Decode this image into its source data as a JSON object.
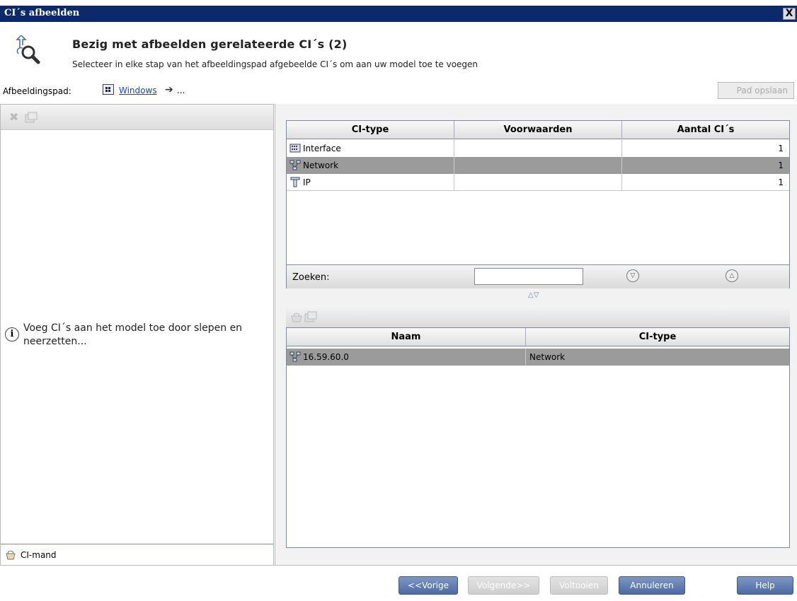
{
  "window": {
    "title": "CI´s afbeelden",
    "close_label": "X"
  },
  "header": {
    "title": "Bezig met afbeelden gerelateerde CI´s (2)",
    "subtitle": "Selecteer in elke stap van het afbeeldingspad afgebeelde CI´s om aan uw model toe te voegen"
  },
  "path": {
    "label": "Afbeeldingspad:",
    "link": "Windows",
    "arrow": "➔",
    "ellipsis": "...",
    "save_button": "Pad opslaan"
  },
  "left_panel": {
    "hint": "Voeg CI´s aan het model toe door slepen en neerzetten...",
    "hint_icon": "i",
    "basket_label": "CI-mand"
  },
  "upper_table": {
    "headers": [
      "CI-type",
      "Voorwaarden",
      "Aantal CI´s"
    ],
    "rows": [
      {
        "icon": "interface-icon",
        "type": "Interface",
        "conditions": "",
        "count": "1",
        "selected": false
      },
      {
        "icon": "network-icon",
        "type": "Network",
        "conditions": "",
        "count": "1",
        "selected": true
      },
      {
        "icon": "ip-icon",
        "type": "IP",
        "conditions": "",
        "count": "1",
        "selected": false
      }
    ]
  },
  "search": {
    "label": "Zoeken:",
    "value": "",
    "up_symbol": "△",
    "down_symbol": "▽"
  },
  "splitter": {
    "symbol": "△▽"
  },
  "lower_table": {
    "headers": [
      "Naam",
      "CI-type"
    ],
    "rows": [
      {
        "icon": "network-icon",
        "name": "16.59.60.0",
        "type": "Network",
        "selected": true
      }
    ]
  },
  "footer": {
    "prev": "<<Vorige",
    "next": "Volgende>>",
    "finish": "Voltooien",
    "cancel": "Annuleren",
    "help": "Help"
  },
  "colors": {
    "titlebar": "#0c2a6a",
    "selection": "#9b9b9b",
    "button": "#5a76ad",
    "link": "#1a44d6"
  }
}
